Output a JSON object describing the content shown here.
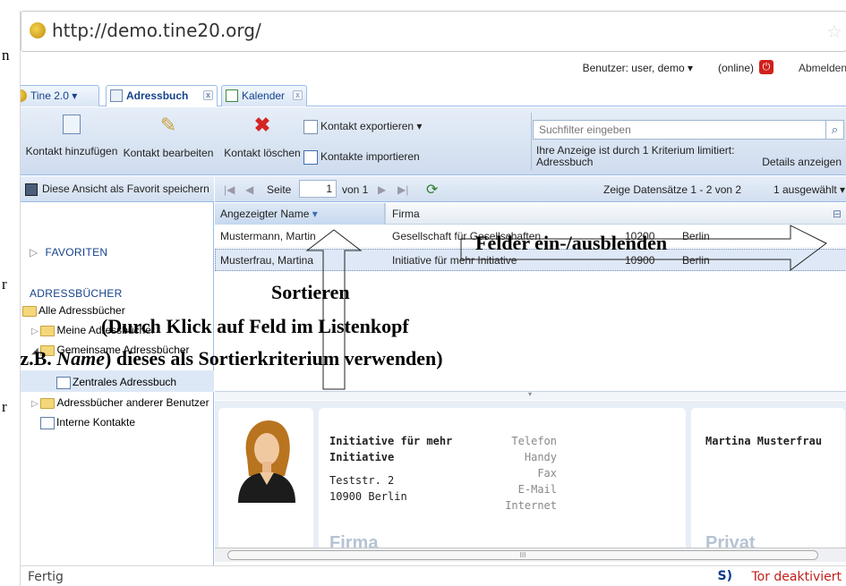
{
  "browser": {
    "url": "http://demo.tine20.org/",
    "status_left": "Fertig",
    "status_s": "S)",
    "status_right": "Tor deaktiviert"
  },
  "margin_letters": [
    "n",
    "r",
    "r"
  ],
  "header": {
    "user_label": "Benutzer: user, demo ▾",
    "online": "(online)",
    "logout": "Abmelden"
  },
  "tabs": [
    {
      "label": "Tine 2.0 ▾"
    },
    {
      "label": "Adressbuch",
      "close": "x"
    },
    {
      "label": "Kalender",
      "close": "x"
    }
  ],
  "toolbar": {
    "add": "Kontakt hinzufügen",
    "edit": "Kontakt bearbeiten",
    "delete": "Kontakt löschen",
    "export": "Kontakt exportieren ▾",
    "import": "Kontakte importieren",
    "search_placeholder": "Suchfilter eingeben",
    "filter_info_line1": "Ihre Anzeige ist durch 1 Kriterium limitiert:",
    "filter_info_line2": "Adressbuch",
    "details": "Details anzeigen"
  },
  "sidebar": {
    "save_favorite": "Diese Ansicht als Favorit speichern",
    "favorites": "FAVORITEN",
    "addressbooks": "ADRESSBÜCHER",
    "items": [
      {
        "label": "Alle Adressbücher"
      },
      {
        "label": "Meine Adressbücher"
      },
      {
        "label": "Gemeinsame Adressbücher"
      },
      {
        "label": "Zentrales Adressbuch"
      },
      {
        "label": "Adressbücher anderer Benutzer"
      },
      {
        "label": "Interne Kontakte"
      }
    ]
  },
  "paging": {
    "page_label": "Seite",
    "page_value": "1",
    "of_label": "von 1",
    "records": "Zeige Datensätze 1 - 2 von 2",
    "selected": "1 ausgewählt ▾"
  },
  "grid": {
    "columns": [
      "Angezeigter Name",
      "Firma"
    ],
    "sort_arrow": "▾",
    "rows": [
      {
        "name": "Mustermann, Martin",
        "company": "Gesellschaft für Gesellschaften",
        "zip": "10200",
        "city": "Berlin"
      },
      {
        "name": "Musterfrau, Martina",
        "company": "Initiative für mehr Initiative",
        "zip": "10900",
        "city": "Berlin"
      }
    ]
  },
  "details": {
    "company_line1": "Initiative für mehr",
    "company_line2": "Initiative",
    "street": "Teststr. 2",
    "city": "10900 Berlin",
    "labels": [
      "Telefon",
      "Handy",
      "Fax",
      "E-Mail",
      "Internet"
    ],
    "section_company": "Firma",
    "person_name": "Martina Musterfrau",
    "section_private": "Privat"
  },
  "annotations": {
    "columns_toggle": "Felder ein-/ausblenden",
    "sort": "Sortieren",
    "line1": "(Durch Klick auf Feld im Listenkopf",
    "line2_prefix": "(z.B. ",
    "line2_italic": "Name",
    "line2_suffix": ") dieses als Sortierkriterium verwenden)"
  },
  "colors": {
    "accent_blue": "#15428b",
    "toolbar_bg": "#d2dff0",
    "logout_red": "#d0211c",
    "tor_red": "#c0201c"
  },
  "icons": [
    "globe-icon",
    "star-icon",
    "power-icon",
    "add-contact-icon",
    "edit-pencil-icon",
    "delete-x-icon",
    "export-icon",
    "import-icon",
    "search-icon",
    "disk-icon",
    "folder-icon",
    "list-icon",
    "refresh-icon",
    "avatar-icon"
  ]
}
